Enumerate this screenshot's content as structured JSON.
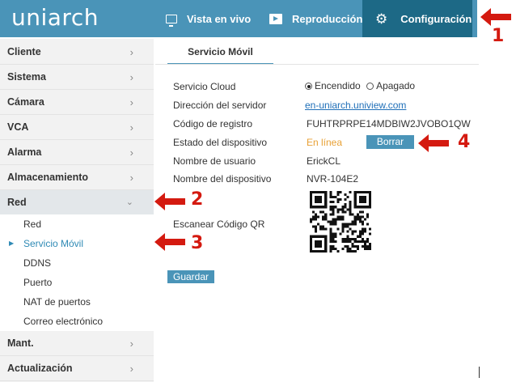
{
  "header": {
    "logo": "uniarch",
    "nav": [
      {
        "label": "Vista en vivo",
        "icon": "monitor-icon"
      },
      {
        "label": "Reproducción",
        "icon": "play-icon"
      },
      {
        "label": "Configuración",
        "icon": "gear-icon"
      }
    ]
  },
  "sidebar": {
    "items": [
      {
        "label": "Cliente"
      },
      {
        "label": "Sistema"
      },
      {
        "label": "Cámara"
      },
      {
        "label": "VCA"
      },
      {
        "label": "Alarma"
      },
      {
        "label": "Almacenamiento"
      },
      {
        "label": "Red"
      },
      {
        "label": "Mant."
      },
      {
        "label": "Actualización"
      }
    ],
    "subitems": [
      {
        "label": "Red"
      },
      {
        "label": "Servicio Móvil"
      },
      {
        "label": "DDNS"
      },
      {
        "label": "Puerto"
      },
      {
        "label": "NAT de puertos"
      },
      {
        "label": "Correo electrónico"
      }
    ]
  },
  "main": {
    "tab": "Servicio Móvil",
    "fields": {
      "cloud_label": "Servicio Cloud",
      "cloud_on": "Encendido",
      "cloud_off": "Apagado",
      "server_label": "Dirección del servidor",
      "server_value": "en-uniarch.uniview.com",
      "code_label": "Código de registro",
      "code_value": "FUHTRPRPE14MDBIW2JVOBO1QW",
      "status_label": "Estado del dispositivo",
      "status_value": "En línea",
      "delete_button": "Borrar",
      "user_label": "Nombre de usuario",
      "user_value": "ErickCL",
      "device_label": "Nombre del dispositivo",
      "device_value": "NVR-104E2",
      "qr_label": "Escanear Código QR"
    },
    "save_button": "Guardar"
  },
  "annotations": [
    "1",
    "2",
    "3",
    "4"
  ],
  "colors": {
    "accent": "#4a94b8",
    "active_nav": "#1d6986",
    "annotation": "#d41a10",
    "online": "#e8a034"
  }
}
